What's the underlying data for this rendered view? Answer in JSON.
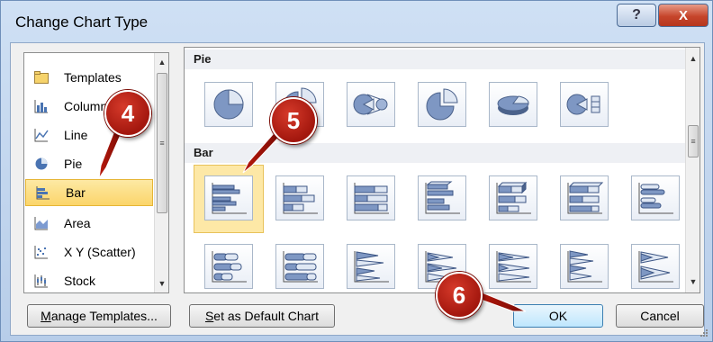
{
  "window": {
    "title": "Change Chart Type",
    "help_glyph": "?",
    "close_glyph": "X"
  },
  "left_list": {
    "items": [
      {
        "label": "Templates",
        "icon": "folder-icon"
      },
      {
        "label": "Column",
        "icon": "column-chart-icon"
      },
      {
        "label": "Line",
        "icon": "line-chart-icon"
      },
      {
        "label": "Pie",
        "icon": "pie-chart-icon"
      },
      {
        "label": "Bar",
        "icon": "bar-chart-icon",
        "selected": true
      },
      {
        "label": "Area",
        "icon": "area-chart-icon"
      },
      {
        "label": "X Y (Scatter)",
        "icon": "scatter-chart-icon"
      },
      {
        "label": "Stock",
        "icon": "stock-chart-icon"
      }
    ]
  },
  "gallery": {
    "pie_header": "Pie",
    "bar_header": "Bar",
    "pie_thumbs": [
      "pie-icon",
      "exploded-pie-icon",
      "pie-of-pie-icon",
      "exploded-pie-3d-icon",
      "pie-3d-icon",
      "bar-of-pie-icon"
    ],
    "bar_row1": [
      "clustered-bar-icon",
      "stacked-bar-icon",
      "100-stacked-bar-icon",
      "clustered-bar-3d-icon",
      "stacked-bar-3d-icon",
      "100-stacked-bar-3d-icon",
      "clustered-cylinder-bar-icon"
    ],
    "bar_row2": [
      "stacked-cylinder-bar-icon",
      "100-stacked-cylinder-bar-icon",
      "clustered-cone-bar-icon",
      "stacked-cone-bar-icon",
      "100-stacked-cone-bar-icon",
      "clustered-pyramid-bar-icon",
      "stacked-pyramid-bar-icon"
    ]
  },
  "buttons": {
    "manage_templates": {
      "mnemonic": "M",
      "rest": "anage Templates..."
    },
    "set_default": {
      "mnemonic": "S",
      "rest": "et as Default Chart"
    },
    "ok": "OK",
    "cancel": "Cancel"
  },
  "callouts": {
    "step4": "4",
    "step5": "5",
    "step6": "6"
  },
  "colors": {
    "selection": "#fbd56a",
    "callout": "#b8180c",
    "accent": "#3c7fb1"
  }
}
